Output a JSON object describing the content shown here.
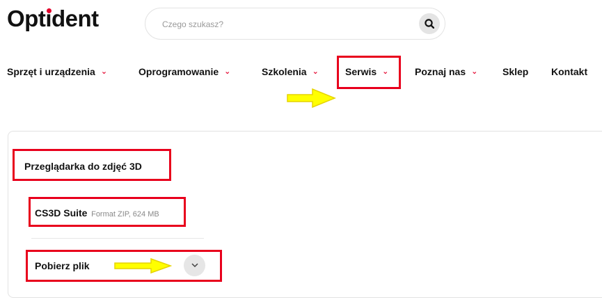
{
  "header": {
    "logo_prefix": "Opt",
    "logo_i": "i",
    "logo_suffix": "dent",
    "search_placeholder": "Czego szukasz?",
    "search_icon": "search-icon"
  },
  "nav": {
    "items": [
      {
        "label": "Sprzęt i urządzenia",
        "has_dropdown": true
      },
      {
        "label": "Oprogramowanie",
        "has_dropdown": true
      },
      {
        "label": "Szkolenia",
        "has_dropdown": true
      },
      {
        "label": "Serwis",
        "has_dropdown": true
      },
      {
        "label": "Poznaj nas",
        "has_dropdown": true
      },
      {
        "label": "Sklep",
        "has_dropdown": false
      },
      {
        "label": "Kontakt",
        "has_dropdown": false
      }
    ],
    "chevron": "⌄"
  },
  "section": {
    "title": "Przeglądarka do zdjęć 3D",
    "file_name": "CS3D Suite",
    "file_meta": "Format ZIP, 624 MB",
    "download_label": "Pobierz plik",
    "toggle_icon": "chevron-down-icon"
  },
  "colors": {
    "brand_red": "#e3002b",
    "annotation_red": "#e8001c",
    "annotation_arrow_yellow": "#ffff00"
  }
}
